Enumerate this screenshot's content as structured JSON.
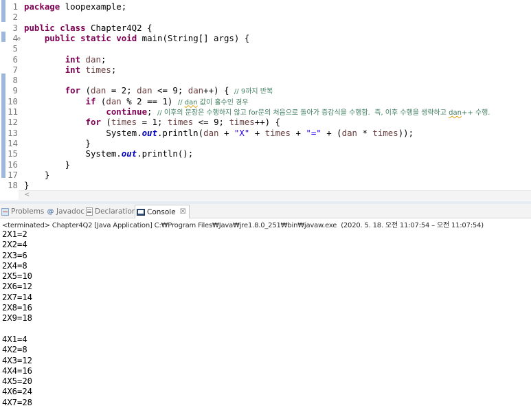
{
  "editor": {
    "lines": [
      {
        "n": "1",
        "fold": "",
        "segments": [
          [
            "kw",
            "package"
          ],
          [
            "",
            " loopexample;"
          ]
        ]
      },
      {
        "n": "2",
        "fold": "",
        "segments": []
      },
      {
        "n": "3",
        "fold": "",
        "segments": [
          [
            "kw",
            "public"
          ],
          [
            "",
            " "
          ],
          [
            "kw",
            "class"
          ],
          [
            "",
            " Chapter4Q2 {"
          ]
        ]
      },
      {
        "n": "4",
        "fold": "⊖",
        "segments": [
          [
            "",
            "    "
          ],
          [
            "kw",
            "public"
          ],
          [
            "",
            " "
          ],
          [
            "kw",
            "static"
          ],
          [
            "",
            " "
          ],
          [
            "kw",
            "void"
          ],
          [
            "",
            " main(String[] args) {"
          ]
        ]
      },
      {
        "n": "5",
        "fold": "",
        "segments": []
      },
      {
        "n": "6",
        "fold": "",
        "segments": [
          [
            "",
            "        "
          ],
          [
            "kw",
            "int"
          ],
          [
            "",
            " "
          ],
          [
            "var",
            "dan"
          ],
          [
            "",
            ";"
          ]
        ]
      },
      {
        "n": "7",
        "fold": "",
        "segments": [
          [
            "",
            "        "
          ],
          [
            "kw",
            "int"
          ],
          [
            "",
            " "
          ],
          [
            "var",
            "times"
          ],
          [
            "",
            ";"
          ]
        ]
      },
      {
        "n": "8",
        "fold": "",
        "segments": []
      },
      {
        "n": "9",
        "fold": "",
        "segments": [
          [
            "",
            "        "
          ],
          [
            "kw",
            "for"
          ],
          [
            "",
            " ("
          ],
          [
            "var",
            "dan"
          ],
          [
            "",
            " = 2; "
          ],
          [
            "var",
            "dan"
          ],
          [
            "",
            " <= 9; "
          ],
          [
            "var",
            "dan"
          ],
          [
            "",
            "++) { "
          ],
          [
            "cm",
            "// 9까지 반복"
          ]
        ]
      },
      {
        "n": "10",
        "fold": "",
        "segments": [
          [
            "",
            "            "
          ],
          [
            "kw",
            "if"
          ],
          [
            "",
            " ("
          ],
          [
            "var",
            "dan"
          ],
          [
            "",
            " % 2 == 1) "
          ],
          [
            "cm",
            "// "
          ],
          [
            "cmsq",
            "dan"
          ],
          [
            "cm",
            " 값이 홀수인 경우"
          ]
        ]
      },
      {
        "n": "11",
        "fold": "",
        "segments": [
          [
            "",
            "                "
          ],
          [
            "kw",
            "continue"
          ],
          [
            "",
            "; "
          ],
          [
            "cm",
            "// 이후의 문장은 수행하지 않고 for문의 처음으로 돌아가 증감식을 수행함.  즉, 이후 수행을 생략하고 "
          ],
          [
            "cmsq",
            "dan"
          ],
          [
            "cm",
            "++ 수행."
          ]
        ]
      },
      {
        "n": "12",
        "fold": "",
        "segments": [
          [
            "",
            "            "
          ],
          [
            "kw",
            "for"
          ],
          [
            "",
            " ("
          ],
          [
            "var",
            "times"
          ],
          [
            "",
            " = 1; "
          ],
          [
            "var",
            "times"
          ],
          [
            "",
            " <= 9; "
          ],
          [
            "var",
            "times"
          ],
          [
            "",
            "++) {"
          ]
        ]
      },
      {
        "n": "13",
        "fold": "",
        "segments": [
          [
            "",
            "                System."
          ],
          [
            "fld",
            "out"
          ],
          [
            "",
            ".println("
          ],
          [
            "var",
            "dan"
          ],
          [
            "",
            " + "
          ],
          [
            "str",
            "\"X\""
          ],
          [
            "",
            " + "
          ],
          [
            "var",
            "times"
          ],
          [
            "",
            " + "
          ],
          [
            "str",
            "\"=\""
          ],
          [
            "",
            " + ("
          ],
          [
            "var",
            "dan"
          ],
          [
            "",
            " * "
          ],
          [
            "var",
            "times"
          ],
          [
            "",
            "));"
          ]
        ]
      },
      {
        "n": "14",
        "fold": "",
        "segments": [
          [
            "",
            "            }"
          ]
        ]
      },
      {
        "n": "15",
        "fold": "",
        "segments": [
          [
            "",
            "            System."
          ],
          [
            "fld",
            "out"
          ],
          [
            "",
            ".println();"
          ]
        ]
      },
      {
        "n": "16",
        "fold": "",
        "segments": [
          [
            "",
            "        }"
          ]
        ]
      },
      {
        "n": "17",
        "fold": "",
        "segments": [
          [
            "",
            "    }"
          ]
        ]
      },
      {
        "n": "18",
        "fold": "",
        "segments": [
          [
            "",
            "}"
          ]
        ]
      }
    ],
    "scroll_left_arrow": "<"
  },
  "views": {
    "tabs": [
      {
        "id": "problems",
        "label": "Problems",
        "icon": "problems-icon",
        "active": false
      },
      {
        "id": "javadoc",
        "label": "Javadoc",
        "icon": "javadoc-icon",
        "active": false
      },
      {
        "id": "declaration",
        "label": "Declaration",
        "icon": "declaration-icon",
        "active": false
      },
      {
        "id": "console",
        "label": "Console",
        "icon": "console-icon",
        "active": true,
        "close": "☒"
      }
    ],
    "console_status": "<terminated> Chapter4Q2 [Java Application] C:₩Program Files₩Java₩jre1.8.0_251₩bin₩javaw.exe  (2020. 5. 18. 오전 11:07:54 – 오전 11:07:54)",
    "console_output": [
      "2X1=2",
      "2X2=4",
      "2X3=6",
      "2X4=8",
      "2X5=10",
      "2X6=12",
      "2X7=14",
      "2X8=16",
      "2X9=18",
      "",
      "4X1=4",
      "4X2=8",
      "4X3=12",
      "4X4=16",
      "4X5=20",
      "4X6=24",
      "4X7=28"
    ]
  },
  "colors": {
    "keyword": "#7f0055",
    "comment": "#3f7f5f",
    "string": "#2a00ff",
    "field": "#0000c0",
    "variable": "#6a3e3e",
    "gutter_highlight": "#9fb7d9"
  }
}
